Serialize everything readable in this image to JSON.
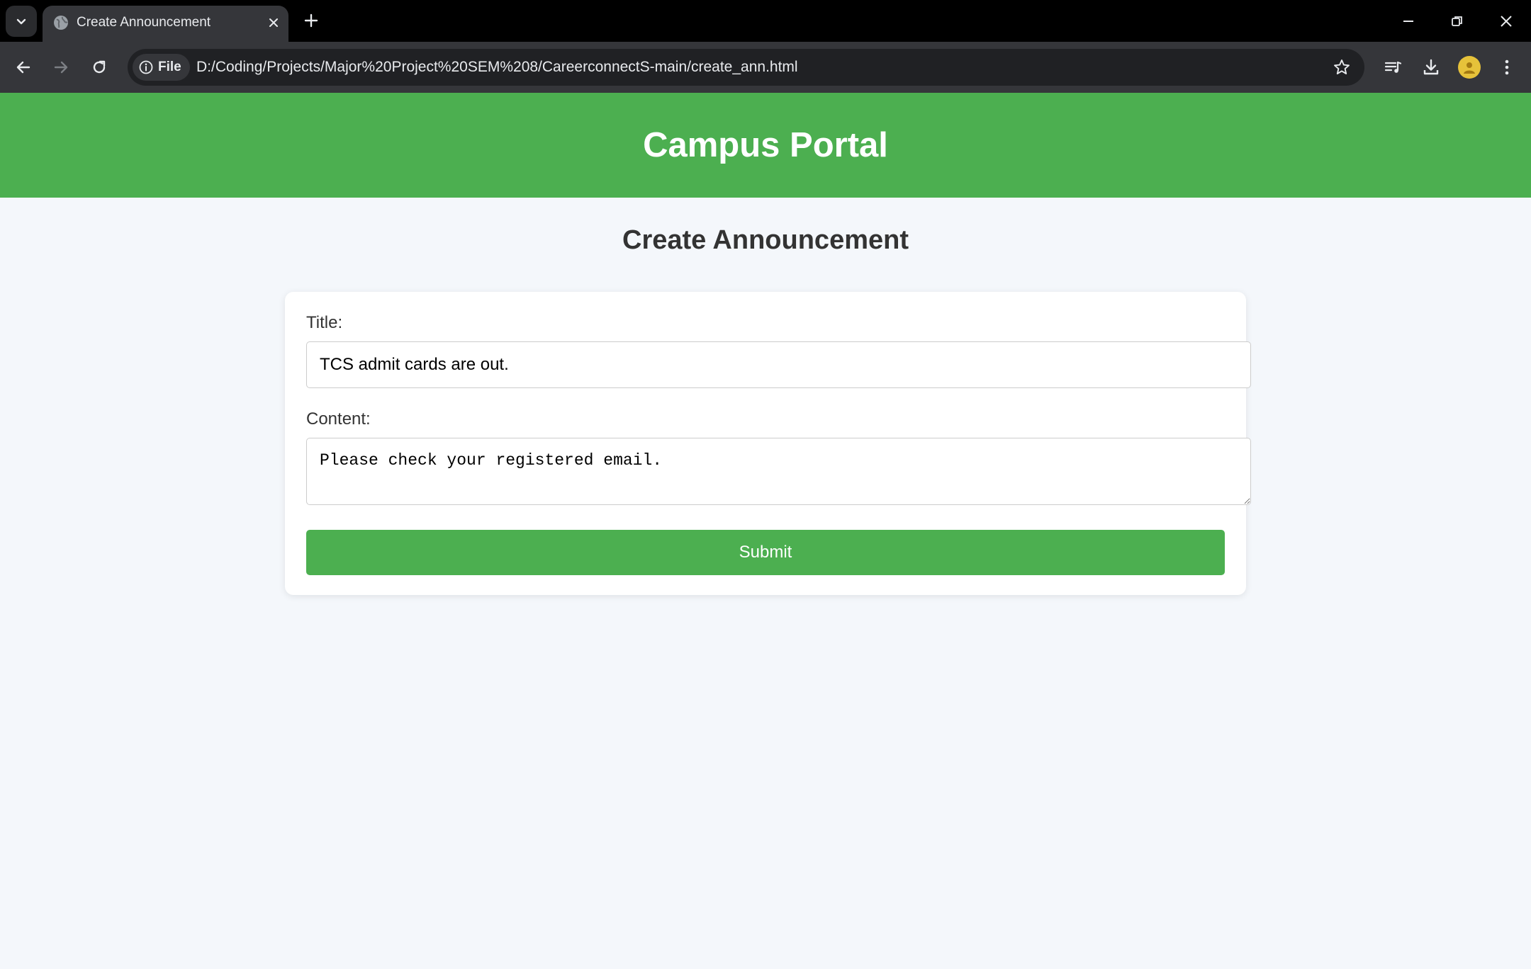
{
  "browser": {
    "tab": {
      "title": "Create Announcement",
      "favicon": "globe-icon"
    },
    "address_bar": {
      "security_chip_label": "File",
      "url": "D:/Coding/Projects/Major%20Project%20SEM%208/CareerconnectS-main/create_ann.html"
    },
    "icons": {
      "tab_list": "chevron-down-icon",
      "tab_close": "close-icon",
      "new_tab": "plus-icon",
      "minimize": "minimize-icon",
      "restore": "restore-icon",
      "window_close": "close-icon",
      "back": "arrow-left-icon",
      "forward": "arrow-right-icon",
      "reload": "reload-icon",
      "site_info": "info-icon",
      "bookmark": "star-icon",
      "media_control": "queue-music-icon",
      "downloads": "download-icon",
      "profile": "avatar",
      "menu": "more-vertical-icon"
    }
  },
  "page": {
    "site_title": "Campus Portal",
    "heading": "Create Announcement",
    "form": {
      "title_label": "Title:",
      "title_value": "TCS admit cards are out.",
      "content_label": "Content:",
      "content_value": "Please check your registered email.",
      "submit_label": "Submit"
    }
  },
  "colors": {
    "header_green": "#4caf50",
    "page_background": "#f4f7fb",
    "browser_chrome": "#35363a",
    "tab_strip": "#000000"
  }
}
